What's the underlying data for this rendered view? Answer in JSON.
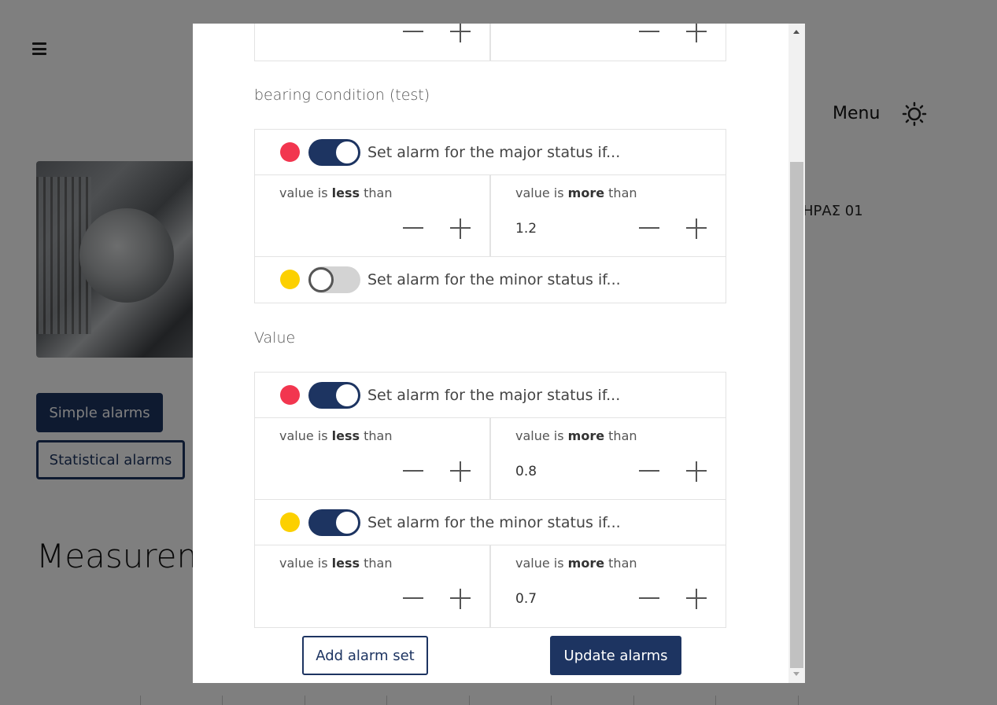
{
  "header": {
    "menu_label": "Menu"
  },
  "asset": {
    "title": "ΗΡΑΣ 01"
  },
  "alarm_tabs": {
    "simple": "Simple alarms",
    "statistical": "Statistical alarms"
  },
  "page": {
    "measurements_heading": "Measurem"
  },
  "modal": {
    "top_partial": {},
    "sections": [
      {
        "title": "bearing condition (test)",
        "major": {
          "enabled": true,
          "dot_color": "#f2364f",
          "label": "Set alarm for the major status if...",
          "less": {
            "prefix": "value is ",
            "keyword": "less",
            "suffix": " than",
            "value": ""
          },
          "more": {
            "prefix": "value is ",
            "keyword": "more",
            "suffix": " than",
            "value": "1.2"
          }
        },
        "minor": {
          "enabled": false,
          "dot_color": "#fcd000",
          "label": "Set alarm for the minor status if..."
        }
      },
      {
        "title": "Value",
        "major": {
          "enabled": true,
          "dot_color": "#f2364f",
          "label": "Set alarm for the major status if...",
          "less": {
            "prefix": "value is ",
            "keyword": "less",
            "suffix": " than",
            "value": ""
          },
          "more": {
            "prefix": "value is ",
            "keyword": "more",
            "suffix": " than",
            "value": "0.8"
          }
        },
        "minor": {
          "enabled": true,
          "dot_color": "#fcd000",
          "label": "Set alarm for the minor status if...",
          "less": {
            "prefix": "value is ",
            "keyword": "less",
            "suffix": " than",
            "value": ""
          },
          "more": {
            "prefix": "value is ",
            "keyword": "more",
            "suffix": " than",
            "value": "0.7"
          }
        }
      }
    ],
    "buttons": {
      "add": "Add alarm set",
      "update": "Update alarms"
    }
  },
  "colors": {
    "primary": "#1d3461",
    "major": "#f2364f",
    "minor": "#fcd000"
  },
  "icons": {
    "menu": "hamburger-icon",
    "theme": "sun-icon",
    "plus": "plus-icon",
    "minus": "minus-icon"
  }
}
